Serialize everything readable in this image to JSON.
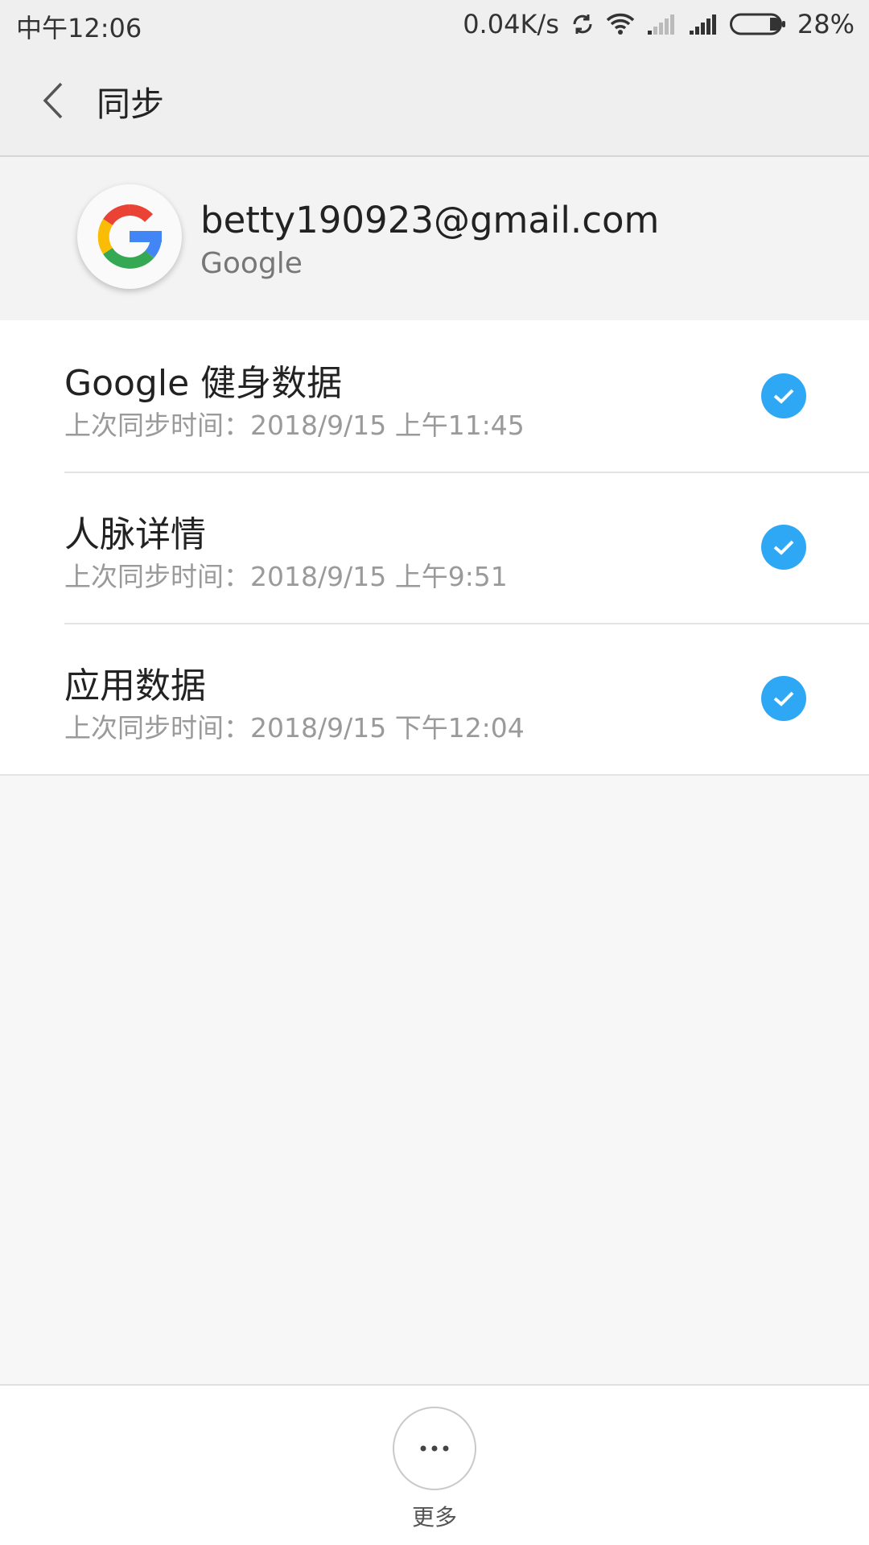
{
  "status_bar": {
    "time": "中午12:06",
    "net_speed": "0.04K/s",
    "battery": "28%"
  },
  "header": {
    "title": "同步"
  },
  "account": {
    "email": "betty190923@gmail.com",
    "provider": "Google",
    "logo_letter": "G"
  },
  "sync_items": [
    {
      "name": "Google 健身数据",
      "last_sync": "上次同步时间：2018/9/15 上午11:45",
      "checked": true
    },
    {
      "name": "人脉详情",
      "last_sync": "上次同步时间：2018/9/15 上午9:51",
      "checked": true
    },
    {
      "name": "应用数据",
      "last_sync": "上次同步时间：2018/9/15 下午12:04",
      "checked": true
    }
  ],
  "bottom": {
    "more_label": "更多"
  },
  "colors": {
    "accent": "#2ea8f4",
    "google_red": "#ea4335",
    "google_blue": "#4285f4",
    "google_green": "#34a853",
    "google_yellow": "#fbbc05"
  }
}
